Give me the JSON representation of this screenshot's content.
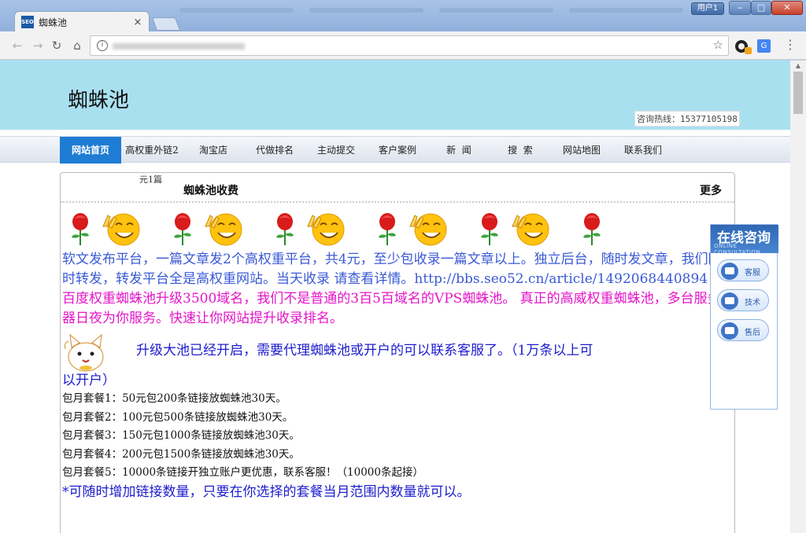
{
  "browser": {
    "tab_title": "蜘蛛池",
    "favicon_text": "SEO",
    "close_glyph": "×",
    "user_button": "用户1",
    "window_controls": {
      "minimize": "‒",
      "maximize": "□",
      "close": "✕"
    },
    "icons": [
      "back-icon",
      "forward-icon",
      "reload-icon",
      "home-icon",
      "info-icon",
      "star-icon",
      "menu-icon"
    ]
  },
  "header": {
    "site_title": "蜘蛛池",
    "hotline": "咨询热线：15377105198"
  },
  "nav": {
    "items": [
      {
        "label": "网站首页",
        "active": true
      },
      {
        "label": "高权重外链2"
      },
      {
        "label": "淘宝店"
      },
      {
        "label": "代做排名"
      },
      {
        "label": "主动提交"
      },
      {
        "label": "客户案例"
      },
      {
        "label": "新  闻"
      },
      {
        "label": "搜  索"
      },
      {
        "label": "网站地图"
      },
      {
        "label": "联系我们"
      }
    ]
  },
  "box": {
    "stray_text": "元1篇",
    "title": "蜘蛛池收费",
    "more": "更多"
  },
  "content": {
    "p1": "软文发布平台，一篇文章发2个高权重平台，共4元，至少包收录一篇文章以上。独立后台，随时发文章，我们随时转发，转发平台全是高权重网站。当天收录 请查看详情。http://bbs.seo52.cn/article/1492068440894",
    "p2": "百度权重蜘蛛池升级3500域名，我们不是普通的3百5百域名的VPS蜘蛛池。 真正的高威权重蜘蛛池，多台服务器日夜为你服务。快速让你网站提升收录排名。",
    "p3a": "升级大池已经开启，需要代理蜘蛛池或开户的可以联系客服了。（1万条以上可",
    "p3b": "以开户）",
    "plans": [
      "包月套餐1：50元包200条链接放蜘蛛池30天。",
      "包月套餐2：100元包500条链接放蜘蛛池30天。",
      "包月套餐3：150元包1000条链接放蜘蛛池30天。",
      "包月套餐4：200元包1500条链接放蜘蛛池30天。",
      "包月套餐5：10000条链接开独立账户更优惠，联系客服！（10000条起接）"
    ],
    "p4": "*可随时增加链接数量，只要在你选择的套餐当月范围内数量就可以。"
  },
  "float_panel": {
    "title": "在线咨询",
    "subtitle": "ONLINE CONSULTATION",
    "buttons": [
      {
        "label": "客服"
      },
      {
        "label": "技术"
      },
      {
        "label": "售后"
      }
    ]
  },
  "colors": {
    "header_bg": "#a9e0f0",
    "nav_active": "#1f7cd4",
    "text_blue": "#3a5ad6",
    "text_magenta": "#e415c8",
    "text_darkblue": "#1c1cce"
  }
}
